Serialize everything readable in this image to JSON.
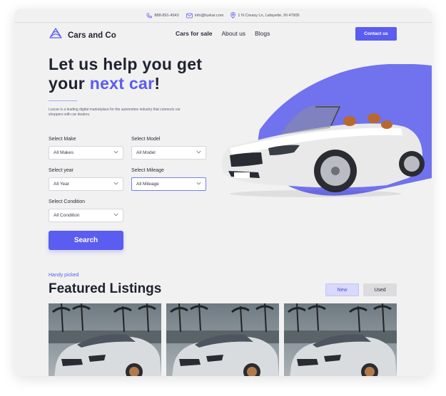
{
  "contact_bar": {
    "phone": "888-891-4543",
    "email": "info@luxkar.com",
    "address": "1 N Creasy Ln, Lafayette, IN 47905"
  },
  "nav": {
    "brand": "Cars and Co",
    "links": [
      "Cars for sale",
      "About us",
      "Blogs"
    ],
    "active_link": "Cars for sale",
    "cta": "Contact us"
  },
  "hero": {
    "title_line1": "Let us help you get",
    "title_line2_prefix": "your ",
    "title_line2_accent": "next car",
    "title_line2_suffix": "!",
    "description": "Luxcar is a leading digital marketplace for the automotive industry that connects car shoppers with car dealers."
  },
  "filters": {
    "make": {
      "label": "Select Make",
      "value": "All Makes"
    },
    "model": {
      "label": "Select Model",
      "value": "All Model"
    },
    "year": {
      "label": "Select year",
      "value": "All Year"
    },
    "mileage": {
      "label": "Select Mileage",
      "value": "All Mileage"
    },
    "condition": {
      "label": "Select Condition",
      "value": "All Condition"
    },
    "search_label": "Search"
  },
  "featured": {
    "eyebrow": "Handy picked",
    "title": "Featured Listings",
    "tabs": [
      "New",
      "Used"
    ],
    "active_tab": "New"
  },
  "colors": {
    "accent": "#5b5cf0",
    "background": "#f1f1f1",
    "heading": "#1f2230"
  },
  "icons": [
    "phone-icon",
    "mail-icon",
    "location-icon",
    "logo-icon",
    "chevron-down-icon"
  ]
}
